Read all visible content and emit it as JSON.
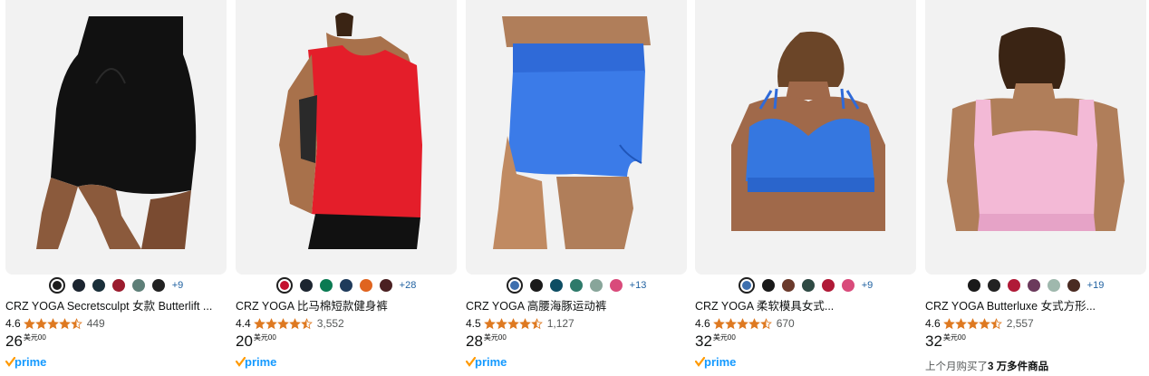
{
  "products": [
    {
      "title": "CRZ YOGA Secretsculpt 女款 Butterlift ...",
      "rating": "4.6",
      "review_count": "449",
      "stars": 4.5,
      "price_whole": "26",
      "price_currency": "美元",
      "price_fraction": "00",
      "prime": "prime",
      "swatches": [
        "#1a1a1a",
        "#1c2530",
        "#1a2f3a",
        "#9b1c2e",
        "#5e7f78",
        "#222222"
      ],
      "selected_swatch": 0,
      "more_colors": "+9"
    },
    {
      "title": "CRZ YOGA 比马棉短款健身裤",
      "rating": "4.4",
      "review_count": "3,552",
      "stars": 4.5,
      "price_whole": "20",
      "price_currency": "美元",
      "price_fraction": "00",
      "prime": "prime",
      "swatches": [
        "#c4122f",
        "#1c2530",
        "#0a7a52",
        "#1f3b5b",
        "#e0641f",
        "#4a2022"
      ],
      "selected_swatch": 0,
      "more_colors": "+28"
    },
    {
      "title": "CRZ YOGA 高腰海豚运动裤",
      "rating": "4.5",
      "review_count": "1,127",
      "stars": 4.5,
      "price_whole": "28",
      "price_currency": "美元",
      "price_fraction": "00",
      "prime": "prime",
      "swatches": [
        "#3d6fae",
        "#1a1a1a",
        "#0d4d63",
        "#2e7a6a",
        "#88a59a",
        "#d94b7b"
      ],
      "selected_swatch": 0,
      "more_colors": "+13"
    },
    {
      "title": "CRZ YOGA 柔软模具女式...",
      "rating": "4.6",
      "review_count": "670",
      "stars": 4.5,
      "price_whole": "32",
      "price_currency": "美元",
      "price_fraction": "00",
      "prime": "prime",
      "swatches": [
        "#3d6fae",
        "#1a1a1a",
        "#6b3a2c",
        "#2f4a44",
        "#b01a37",
        "#d94b7b"
      ],
      "selected_swatch": 0,
      "more_colors": "+9"
    },
    {
      "title": "CRZ YOGA Butterluxe 女式方形...",
      "rating": "4.6",
      "review_count": "2,557",
      "stars": 4.5,
      "price_whole": "32",
      "price_currency": "美元",
      "price_fraction": "00",
      "bought_prefix": "上个月购买了",
      "bought_count": "3 万多件商品",
      "swatches": [
        "#1a1a1a",
        "#222222",
        "#b01a37",
        "#6b3a5c",
        "#9fb8ad",
        "#4a2b22"
      ],
      "selected_swatch": -1,
      "more_colors": "+19"
    }
  ],
  "colors": {
    "star": "#de7921",
    "link": "#2162a1",
    "prime_blue": "#1399ff",
    "prime_check": "#ff9900"
  }
}
